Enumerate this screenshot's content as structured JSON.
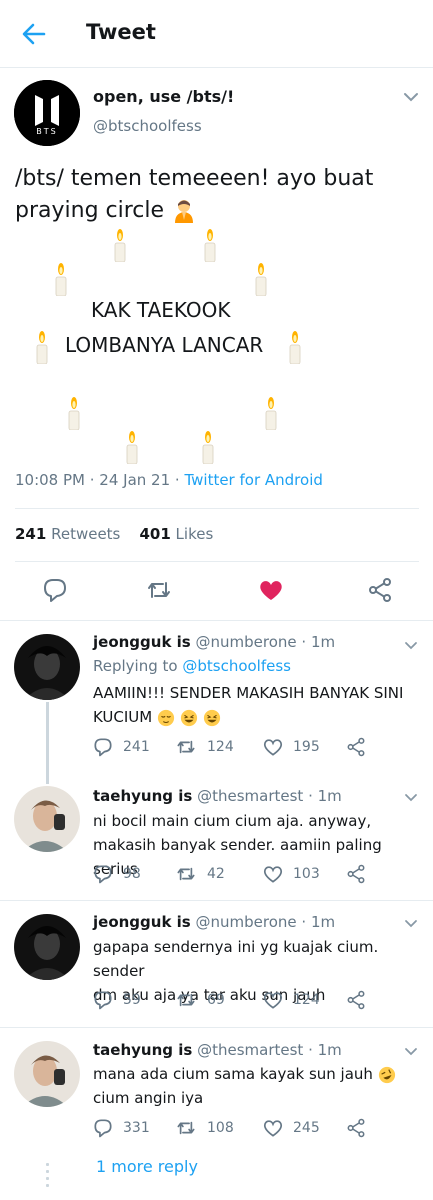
{
  "header": {
    "title": "Tweet"
  },
  "tweet": {
    "author_name": "open, use /bts/!",
    "author_handle": "@btschoolfess",
    "avatar_text": "BTS",
    "line1": "/bts/ temen temeeeen! ayo buat",
    "line2": "praying circle",
    "center_line1": "KAK TAEKOOK",
    "center_line2": "LOMBANYA LANCAR",
    "time": "10:08 PM",
    "date": "24 Jan 21",
    "source": "Twitter for Android",
    "retweets_count": "241",
    "retweets_label": "Retweets",
    "likes_count": "401",
    "likes_label": "Likes",
    "liked": true,
    "like_color": "#e0245e"
  },
  "replies": [
    {
      "name": "jeongguk is",
      "handle": "@numberone",
      "time": "1m",
      "replying_to_label": "Replying to",
      "replying_to": "@btschoolfess",
      "line1": "AAMIIN!!! SENDER MAKASIH BANYAK SINI",
      "line2": "KUCIUM",
      "replies": "241",
      "retweets": "124",
      "likes": "195"
    },
    {
      "name": "taehyung is",
      "handle": "@thesmartest",
      "time": "1m",
      "line1": "ni bocil main cium cium aja. anyway,",
      "line2": "makasih banyak sender. aamiin paling serius",
      "replies": "98",
      "retweets": "42",
      "likes": "103"
    },
    {
      "name": "jeongguk is",
      "handle": "@numberone",
      "time": "1m",
      "line1": "gapapa sendernya ini yg kuajak cium. sender",
      "line2": "dm aku aja ya tar aku sun jauh",
      "replies": "59",
      "retweets": "69",
      "likes": "124"
    },
    {
      "name": "taehyung is",
      "handle": "@thesmartest",
      "time": "1m",
      "line1": "mana ada cium sama kayak sun jauh",
      "line2": "cium angin iya",
      "replies": "331",
      "retweets": "108",
      "likes": "245"
    }
  ],
  "more_replies": "1 more reply",
  "colors": {
    "accent": "#1da1f2",
    "muted": "#657786",
    "like": "#e0245e"
  }
}
